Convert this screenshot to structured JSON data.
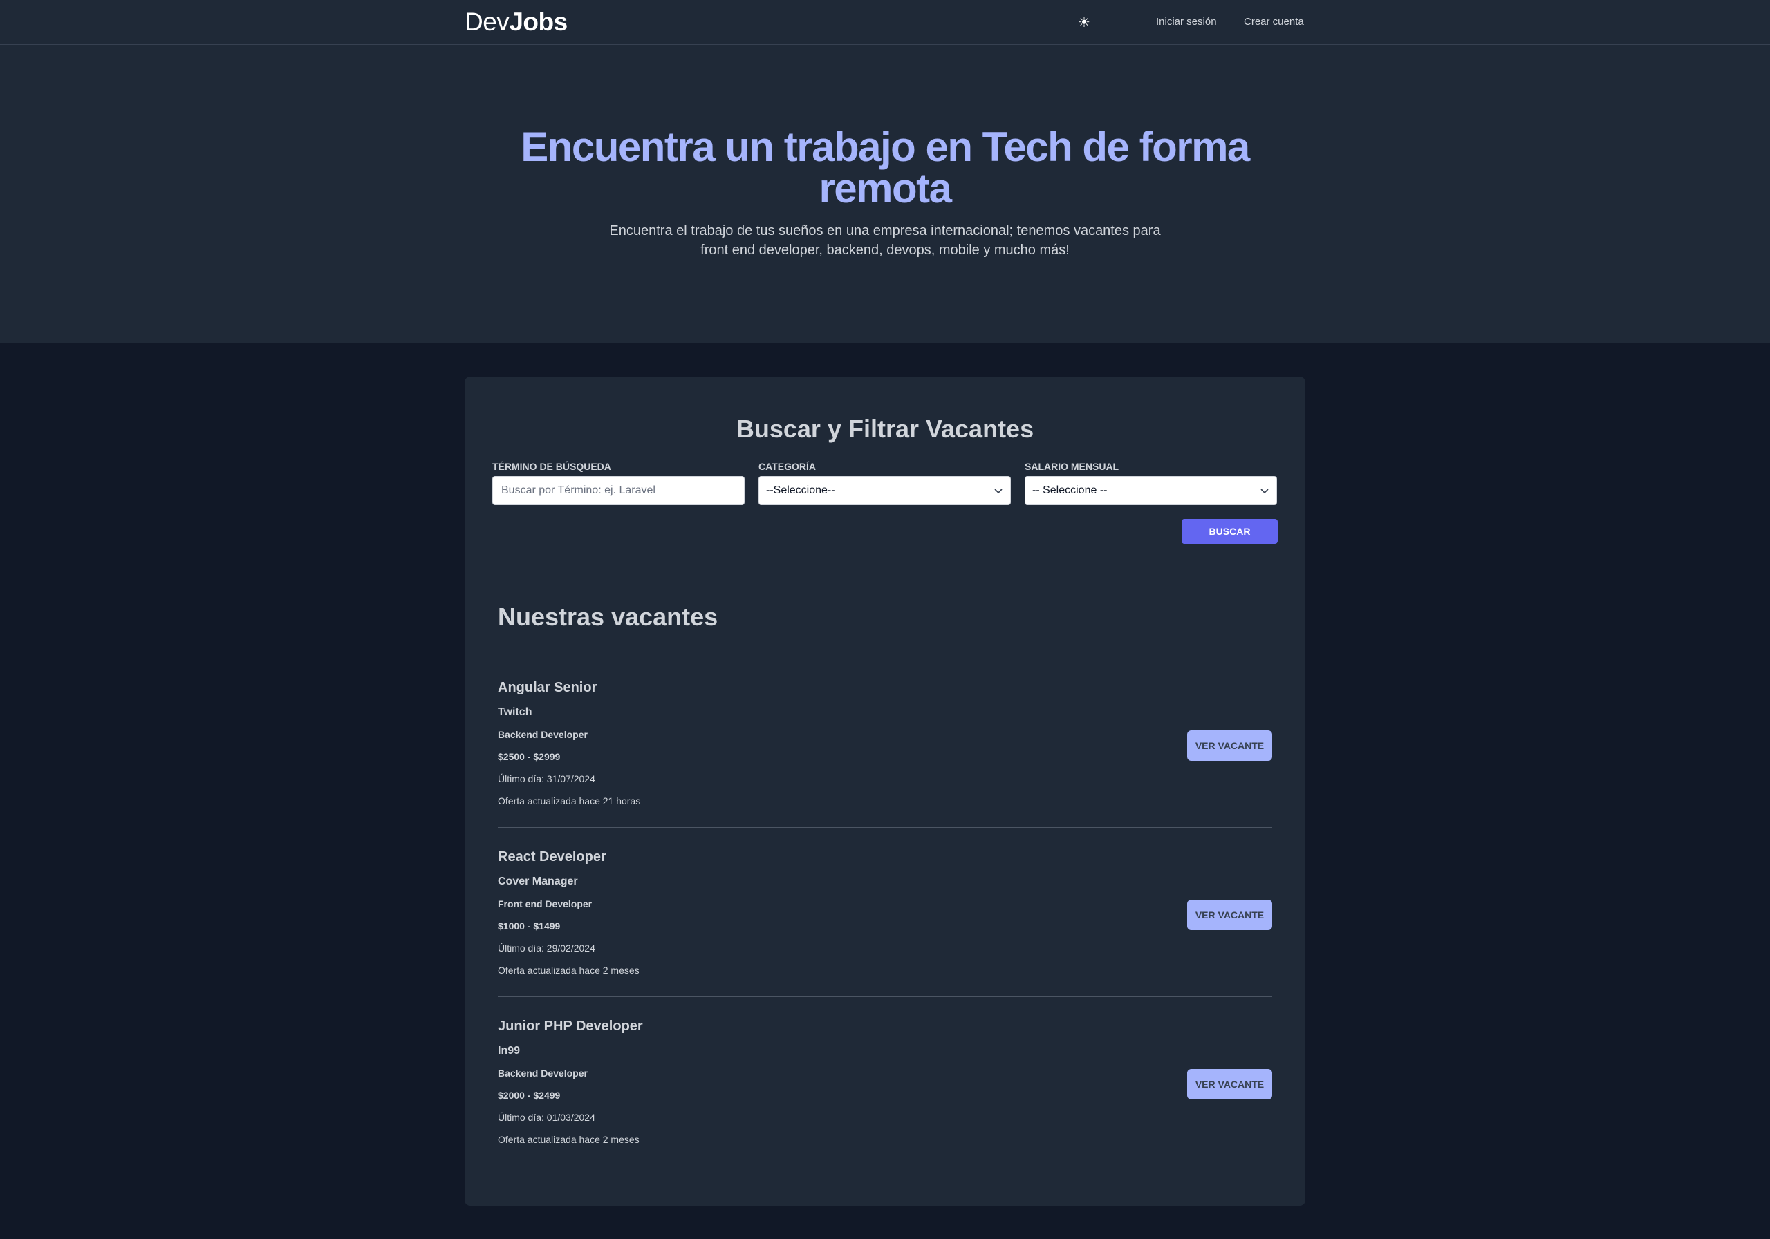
{
  "navbar": {
    "logo_light": "Dev",
    "logo_bold": "Jobs",
    "theme_icon": "☀",
    "login_label": "Iniciar sesión",
    "register_label": "Crear cuenta"
  },
  "hero": {
    "title": "Encuentra un trabajo en Tech de forma remota",
    "subtitle": "Encuentra el trabajo de tus sueños en una empresa internacional; tenemos vacantes para front end developer, backend, devops, mobile y mucho más!"
  },
  "filters": {
    "title": "Buscar y Filtrar Vacantes",
    "search_label": "Término de búsqueda",
    "search_placeholder": "Buscar por Término: ej. Laravel",
    "search_value": "",
    "category_label": "Categoría",
    "category_selected": "--Seleccione--",
    "salary_label": "Salario Mensual",
    "salary_selected": "-- Seleccione --",
    "search_button": "Buscar"
  },
  "jobs": {
    "title": "Nuestras vacantes",
    "view_button": "Ver Vacante",
    "items": [
      {
        "title": "Angular Senior",
        "company": "Twitch",
        "category": "Backend Developer",
        "salary": "$2500 - $2999",
        "deadline": "Último día: 31/07/2024",
        "updated": "Oferta actualizada hace 21 horas"
      },
      {
        "title": "React Developer",
        "company": "Cover Manager",
        "category": "Front end Developer",
        "salary": "$1000 - $1499",
        "deadline": "Último día: 29/02/2024",
        "updated": "Oferta actualizada hace 2 meses"
      },
      {
        "title": "Junior PHP Developer",
        "company": "In99",
        "category": "Backend Developer",
        "salary": "$2000 - $2499",
        "deadline": "Último día: 01/03/2024",
        "updated": "Oferta actualizada hace 2 meses"
      }
    ]
  },
  "colors": {
    "page_bg": "#111827",
    "panel_bg": "#1f2937",
    "accent": "#a5b4fc",
    "button_primary": "#6366f1"
  }
}
